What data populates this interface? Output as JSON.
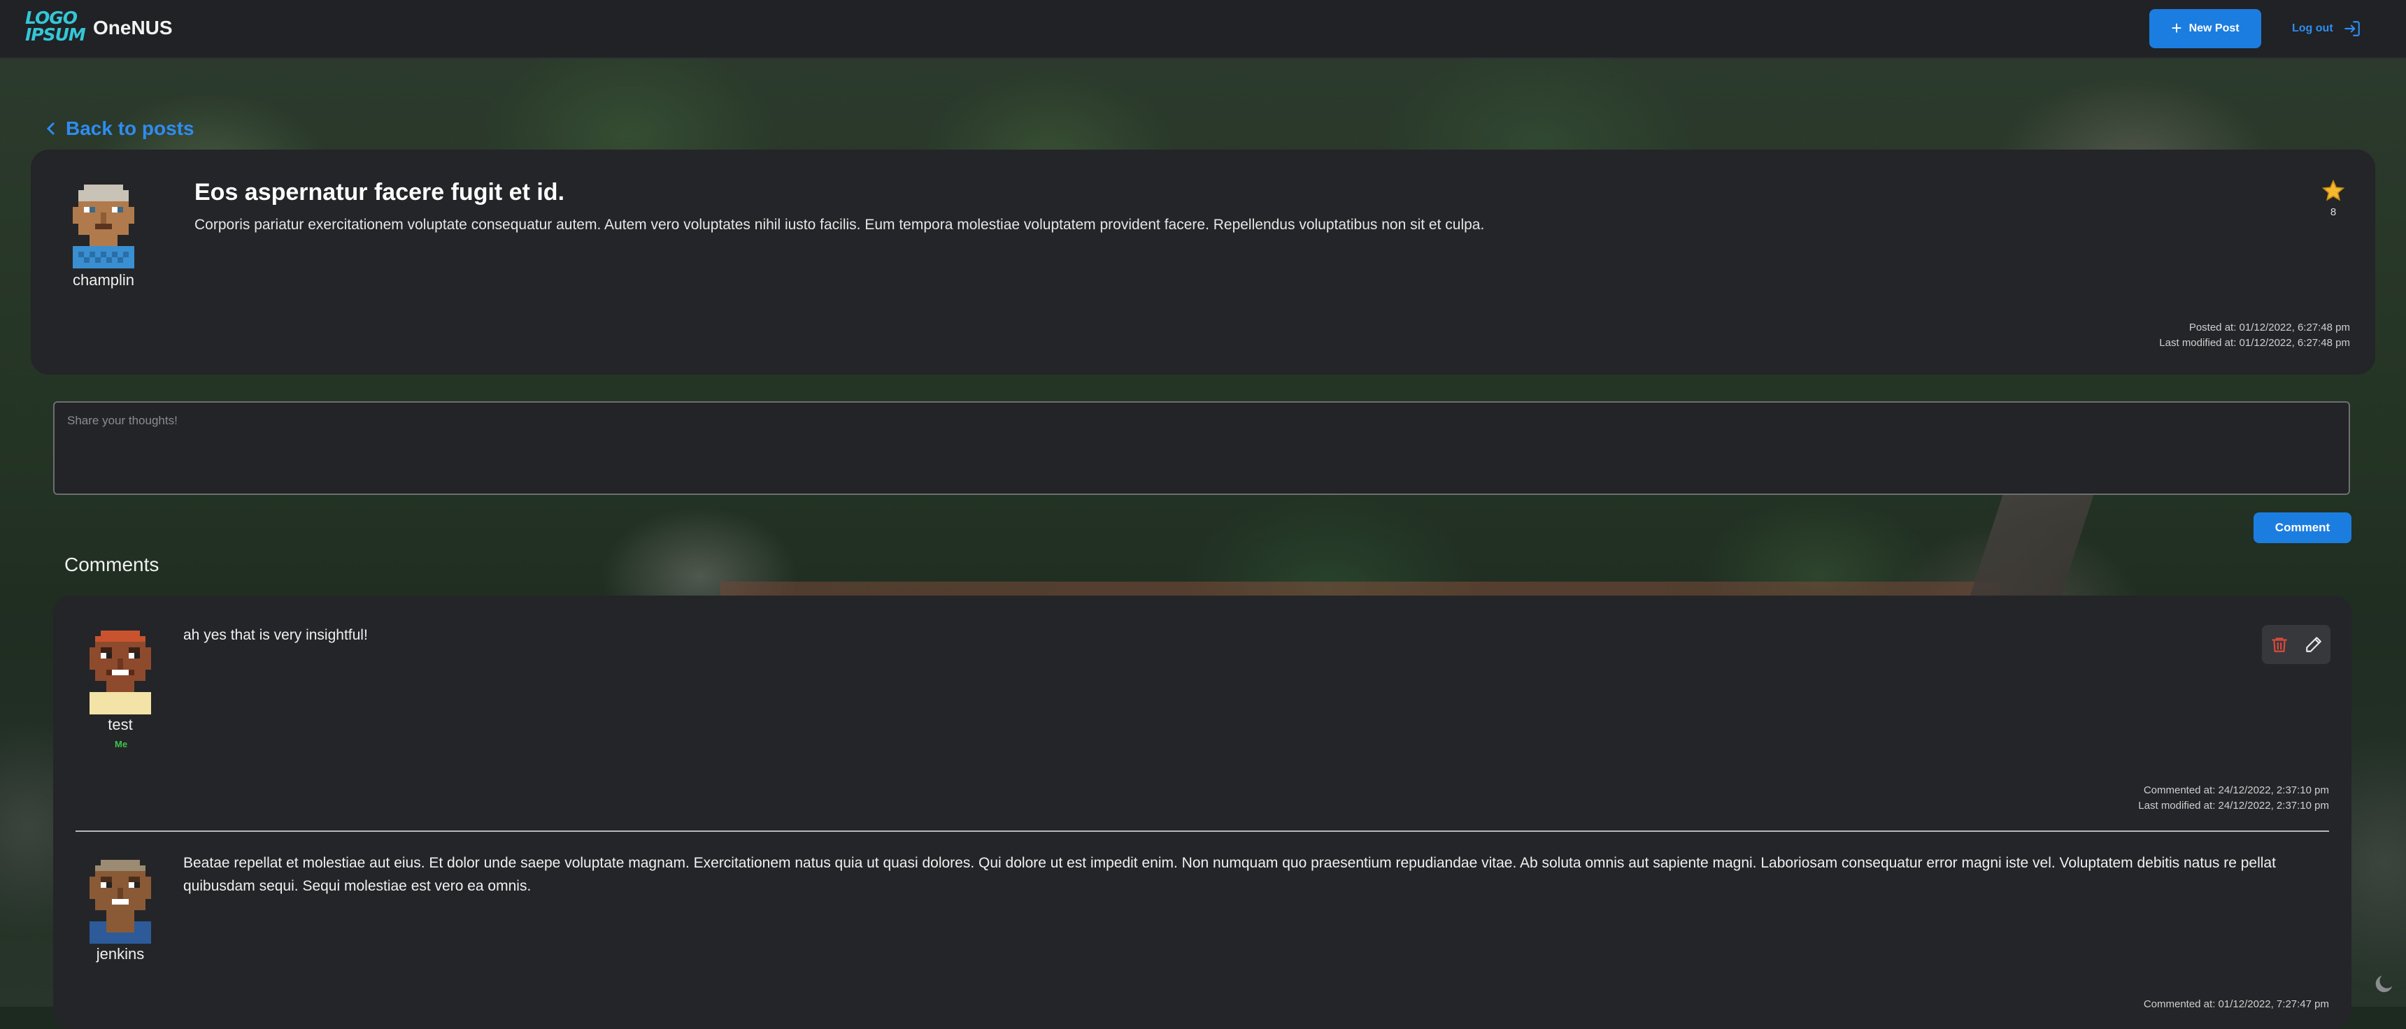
{
  "header": {
    "logo_line1": "LOGO",
    "logo_line2": "IPSUM",
    "app_title": "OneNUS",
    "new_post_label": "New Post",
    "logout_label": "Log out"
  },
  "back_link": "Back to posts",
  "post": {
    "author": "champlin",
    "title": "Eos aspernatur facere fugit et id.",
    "body": "Corporis pariatur exercitationem voluptate consequatur autem. Autem vero voluptates nihil iusto facilis. Eum tempora molestiae voluptatem provident facere. Repellendus voluptatibus non sit et culpa.",
    "star_count": "8",
    "posted_at": "Posted at: 01/12/2022, 6:27:48 pm",
    "last_modified": "Last modified at: 01/12/2022, 6:27:48 pm"
  },
  "comment_input": {
    "placeholder": "Share your thoughts!"
  },
  "comment_button": "Comment",
  "comments_heading": "Comments",
  "comments": [
    {
      "author": "test",
      "badge": "Me",
      "text": "ah yes that is very insightful!",
      "commented_at": "Commented at: 24/12/2022, 2:37:10 pm",
      "last_modified": "Last modified at: 24/12/2022, 2:37:10 pm"
    },
    {
      "author": "jenkins",
      "text": "Beatae repellat et molestiae aut eius. Et dolor unde saepe voluptate magnam. Exercitationem natus quia ut quasi dolores. Qui dolore ut est impedit enim. Non numquam quo praesentium repudiandae vitae. Ab soluta omnis aut sapiente magni. Laboriosam consequatur error magni iste vel. Voluptatem debitis natus re pellat quibusdam sequi. Sequi molestiae est vero ea omnis.",
      "commented_at": "Commented at: 01/12/2022, 7:27:47 pm"
    }
  ],
  "colors": {
    "accent": "#1c7de0",
    "link": "#2f8cf0",
    "star": "#f5b82e",
    "me_badge": "#3ec44c",
    "delete": "#d84a3a"
  }
}
